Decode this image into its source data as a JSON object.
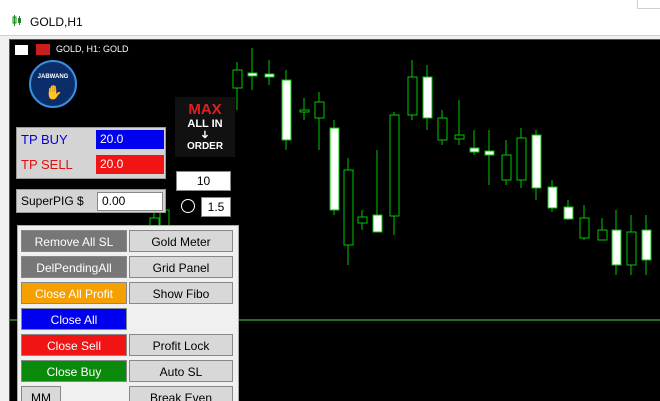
{
  "window": {
    "title": "GOLD,H1"
  },
  "chart": {
    "label": "GOLD, H1:  GOLD",
    "bull_color": "#00c800",
    "bear_color": "#ffffff",
    "line_color": "#4ad44a"
  },
  "logo": {
    "text": "JABWANG"
  },
  "max_order": {
    "max": "MAX",
    "allin": "ALL IN",
    "arrow": "➜",
    "order": "ORDER"
  },
  "lots": {
    "lot_value": "10",
    "multiplier_value": "1.5"
  },
  "tp": {
    "buy_label": "TP BUY",
    "buy_value": "20.0",
    "buy_color": "#0000f0",
    "sell_label": "TP SELL",
    "sell_value": "20.0",
    "sell_color": "#f01414"
  },
  "superpig": {
    "label": "SuperPIG $",
    "value": "0.00"
  },
  "buttons": {
    "remove_all_sl": "Remove All SL",
    "gold_meter": "Gold Meter",
    "del_pending_all": "DelPendingAll",
    "grid_panel": "Grid Panel",
    "close_all_profit": "Close All Profit",
    "show_fibo": "Show Fibo",
    "close_all": "Close All",
    "close_sell": "Close Sell",
    "profit_lock": "Profit Lock",
    "close_buy": "Close Buy",
    "auto_sl": "Auto SL",
    "mm": "MM",
    "break_even": "Break Even"
  },
  "icons": {
    "window_icon": "candlestick-icon",
    "chart_icon_1": "table-icon",
    "chart_icon_2": "ea-icon",
    "logo_icon": "hand-icon",
    "crosshair_icon": "crosshair-icon"
  }
}
